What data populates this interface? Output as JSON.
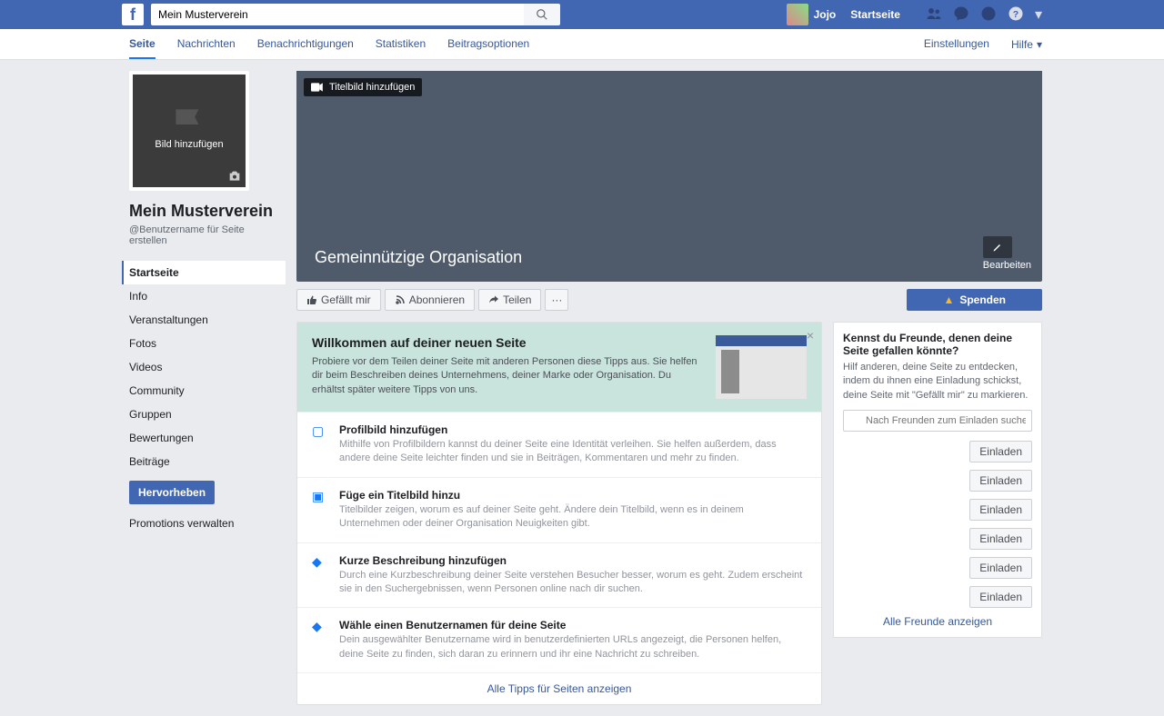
{
  "topbar": {
    "search_value": "Mein Musterverein",
    "user_name": "Jojo",
    "home_label": "Startseite"
  },
  "subnav": {
    "tabs": [
      "Seite",
      "Nachrichten",
      "Benachrichtigungen",
      "Statistiken",
      "Beitragsoptionen"
    ],
    "settings": "Einstellungen",
    "help": "Hilfe"
  },
  "left": {
    "add_image": "Bild hinzufügen",
    "page_name": "Mein Musterverein",
    "username_hint": "@Benutzername für Seite erstellen",
    "nav": [
      "Startseite",
      "Info",
      "Veranstaltungen",
      "Fotos",
      "Videos",
      "Community",
      "Gruppen",
      "Bewertungen",
      "Beiträge"
    ],
    "promote": "Hervorheben",
    "manage_promos": "Promotions verwalten"
  },
  "cover": {
    "add_cover": "Titelbild hinzufügen",
    "category": "Gemeinnützige Organisation",
    "edit": "Bearbeiten"
  },
  "actions": {
    "like": "Gefällt mir",
    "subscribe": "Abonnieren",
    "share": "Teilen",
    "donate": "Spenden"
  },
  "welcome": {
    "title": "Willkommen auf deiner neuen Seite",
    "body": "Probiere vor dem Teilen deiner Seite mit anderen Personen diese Tipps aus. Sie helfen dir beim Beschreiben deines Unternehmens, deiner Marke oder Organisation. Du erhältst später weitere Tipps von uns.",
    "tips": [
      {
        "title": "Profilbild hinzufügen",
        "body": "Mithilfe von Profilbildern kannst du deiner Seite eine Identität verleihen. Sie helfen außerdem, dass andere deine Seite leichter finden und sie in Beiträgen, Kommentaren und mehr zu finden."
      },
      {
        "title": "Füge ein Titelbild hinzu",
        "body": "Titelbilder zeigen, worum es auf deiner Seite geht. Ändere dein Titelbild, wenn es in deinem Unternehmen oder deiner Organisation Neuigkeiten gibt."
      },
      {
        "title": "Kurze Beschreibung hinzufügen",
        "body": "Durch eine Kurzbeschreibung deiner Seite verstehen Besucher besser, worum es geht. Zudem erscheint sie in den Suchergebnissen, wenn Personen online nach dir suchen."
      },
      {
        "title": "Wähle einen Benutzernamen für deine Seite",
        "body": "Dein ausgewählter Benutzername wird in benutzerdefinierten URLs angezeigt, die Personen helfen, deine Seite zu finden, sich daran zu erinnern und ihr eine Nachricht zu schreiben."
      }
    ],
    "footer": "Alle Tipps für Seiten anzeigen"
  },
  "friends": {
    "title": "Kennst du Freunde, denen deine Seite gefallen könnte?",
    "sub": "Hilf anderen, deine Seite zu entdecken, indem du ihnen eine Einladung schickst, deine Seite mit \"Gefällt mir\" zu markieren.",
    "search_placeholder": "Nach Freunden zum Einladen suchen",
    "invite": "Einladen",
    "count": 6,
    "footer": "Alle Freunde anzeigen"
  }
}
